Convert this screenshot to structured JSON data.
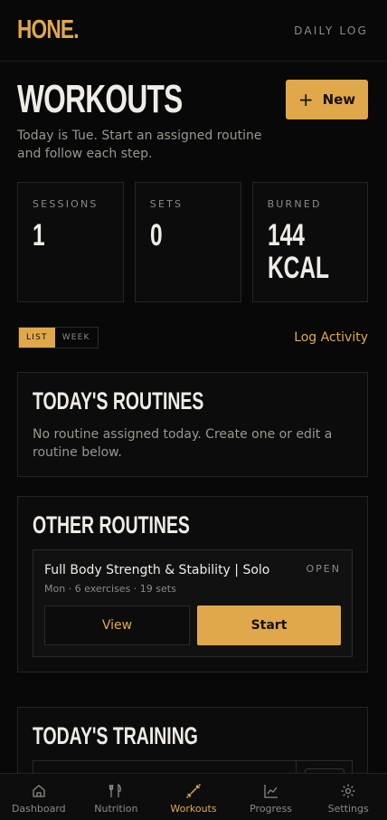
{
  "brand": "HONE.",
  "header": {
    "daily_log": "DAILY LOG"
  },
  "page": {
    "title": "WORKOUTS",
    "new_label": "New",
    "subtitle": "Today is Tue. Start an assigned routine and follow each step."
  },
  "stats": [
    {
      "label": "SESSIONS",
      "value": "1"
    },
    {
      "label": "SETS",
      "value": "0"
    },
    {
      "label": "BURNED",
      "value": "144",
      "unit": "KCAL"
    }
  ],
  "view_toggle": {
    "list": "LIST",
    "week": "WEEK",
    "selected": "LIST"
  },
  "log_activity": "Log Activity",
  "todays_routines": {
    "title": "TODAY'S ROUTINES",
    "empty_text": "No routine assigned today. Create one or edit a routine below."
  },
  "other_routines": {
    "title": "OTHER ROUTINES",
    "items": [
      {
        "name": "Full Body Strength & Stability | Solo",
        "status": "OPEN",
        "meta": "Mon · 6 exercises · 19 sets",
        "view_label": "View",
        "start_label": "Start"
      }
    ]
  },
  "todays_training": {
    "title": "TODAY'S TRAINING"
  },
  "nav": [
    {
      "label": "Dashboard",
      "icon": "home-icon"
    },
    {
      "label": "Nutrition",
      "icon": "fork-knife-icon"
    },
    {
      "label": "Workouts",
      "icon": "dumbbell-icon",
      "active": true
    },
    {
      "label": "Progress",
      "icon": "chart-icon"
    },
    {
      "label": "Settings",
      "icon": "gear-icon"
    }
  ],
  "colors": {
    "accent": "#e0a84b",
    "background": "#080808",
    "card": "#0c0c0c"
  }
}
